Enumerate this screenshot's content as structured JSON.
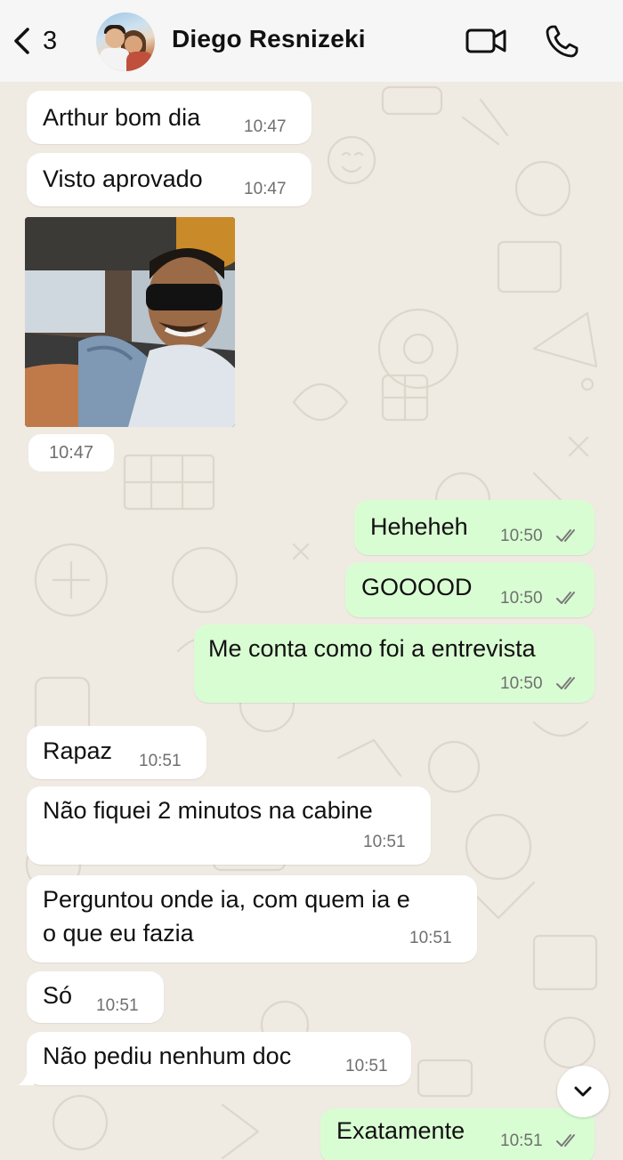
{
  "header": {
    "back_count": "3",
    "contact_name": "Diego Resnizeki",
    "icons": {
      "back": "chevron-left-icon",
      "video": "video-camera-icon",
      "call": "phone-icon"
    }
  },
  "messages": [
    {
      "dir": "in",
      "text": "Arthur bom dia",
      "time": "10:47"
    },
    {
      "dir": "in",
      "text": "Visto aprovado",
      "time": "10:47"
    },
    {
      "dir": "in",
      "type": "image",
      "time": "10:47"
    },
    {
      "dir": "out",
      "text": "Heheheh",
      "time": "10:50",
      "status": "read"
    },
    {
      "dir": "out",
      "text": "GOOOOD",
      "time": "10:50",
      "status": "read"
    },
    {
      "dir": "out",
      "text": "Me conta como foi a entrevista",
      "time": "10:50",
      "status": "read"
    },
    {
      "dir": "in",
      "text": "Rapaz",
      "time": "10:51"
    },
    {
      "dir": "in",
      "text": "Não fiquei 2 minutos na cabine",
      "time": "10:51"
    },
    {
      "dir": "in",
      "lines": [
        "Perguntou onde ia, com quem ia e",
        "o que eu fazia"
      ],
      "time": "10:51"
    },
    {
      "dir": "in",
      "text": "Só",
      "time": "10:51"
    },
    {
      "dir": "in",
      "text": "Não pediu nenhum doc",
      "time": "10:51"
    },
    {
      "dir": "out",
      "text": "Exatamente",
      "time": "10:51",
      "status": "read"
    }
  ],
  "scroll_down": {
    "icon": "chevron-down-icon"
  },
  "colors": {
    "incoming": "#ffffff",
    "outgoing": "#d9fdd3",
    "wallpaper": "#efeae2",
    "ticks": "#7a7a7a"
  }
}
